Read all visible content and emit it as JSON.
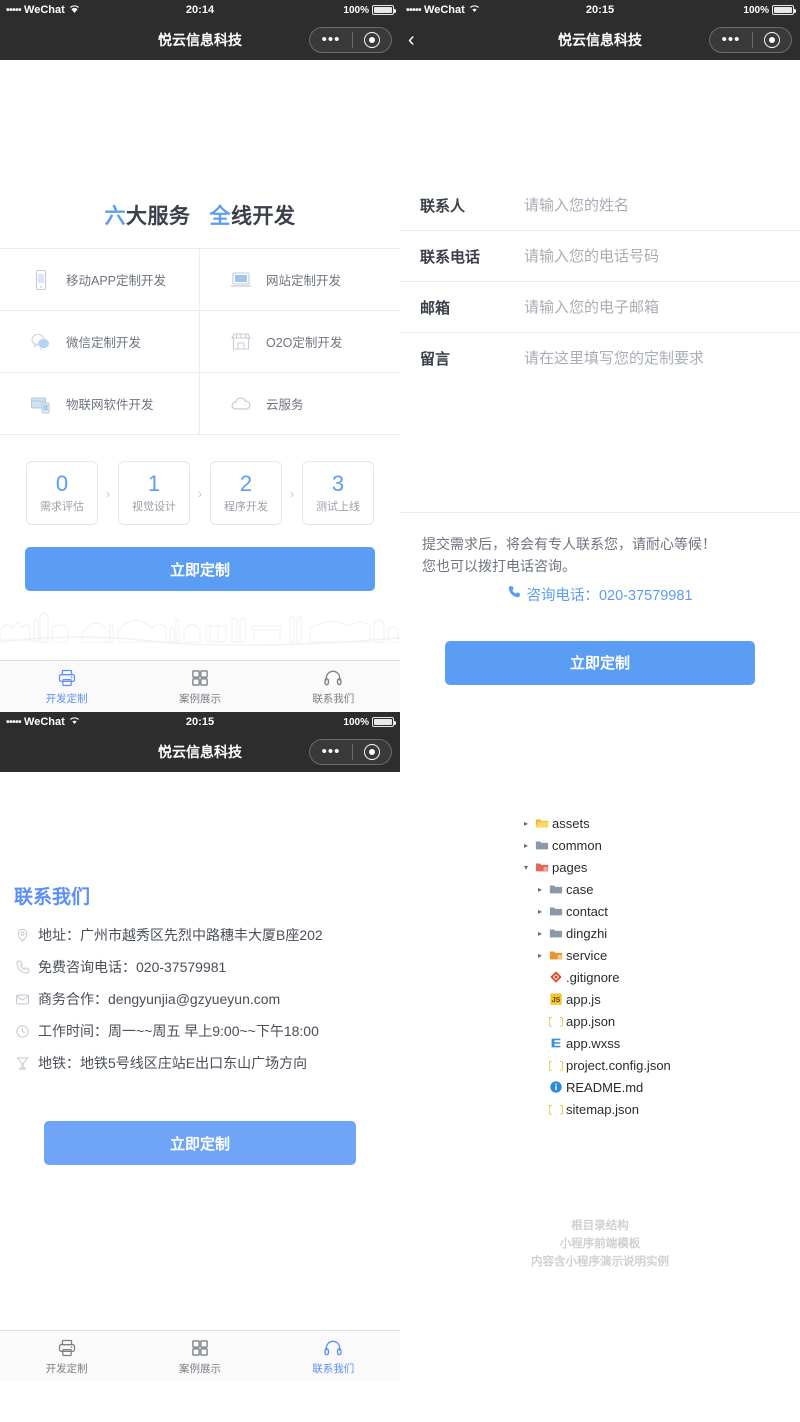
{
  "panel1": {
    "status": {
      "dots": "•••••",
      "carrier": "WeChat",
      "wifi": "wifi-icon",
      "time": "20:14",
      "battery_pct": "100%"
    },
    "nav": {
      "title": "悦云信息科技",
      "has_back": false,
      "menu_icon": "more-dots-icon",
      "target_icon": "target-circle-icon"
    },
    "section_title": {
      "part1_highlight": "六",
      "part1_rest": "大服务",
      "part2_highlight": "全",
      "part2_rest": "线开发"
    },
    "services": [
      {
        "label": "移动APP定制开发",
        "icon": "mobile-phone-icon"
      },
      {
        "label": "网站定制开发",
        "icon": "laptop-icon"
      },
      {
        "label": "微信定制开发",
        "icon": "wechat-bubble-icon"
      },
      {
        "label": "O2O定制开发",
        "icon": "storefront-icon"
      },
      {
        "label": "物联网软件开发",
        "icon": "iot-devices-icon"
      },
      {
        "label": "云服务",
        "icon": "cloud-icon"
      }
    ],
    "steps": [
      {
        "num": "0",
        "label": "需求评估"
      },
      {
        "num": "1",
        "label": "视觉设计"
      },
      {
        "num": "2",
        "label": "程序开发"
      },
      {
        "num": "3",
        "label": "测试上线"
      }
    ],
    "step_arrow": "›",
    "cta_label": "立即定制",
    "tabs": [
      {
        "label": "开发定制",
        "icon": "printer-custom-icon",
        "active": true
      },
      {
        "label": "案例展示",
        "icon": "grid-squares-icon",
        "active": false
      },
      {
        "label": "联系我们",
        "icon": "headset-icon",
        "active": false
      }
    ]
  },
  "panel2": {
    "status": {
      "dots": "•••••",
      "carrier": "WeChat",
      "wifi": "wifi-icon",
      "time": "20:15",
      "battery_pct": "100%"
    },
    "nav": {
      "title": "悦云信息科技",
      "has_back": true,
      "back_icon": "chevron-left-icon",
      "menu_icon": "more-dots-icon",
      "target_icon": "target-circle-icon"
    },
    "form": [
      {
        "label": "联系人",
        "placeholder": "请输入您的姓名"
      },
      {
        "label": "联系电话",
        "placeholder": "请输入您的电话号码"
      },
      {
        "label": "邮箱",
        "placeholder": "请输入您的电子邮箱"
      },
      {
        "label": "留言",
        "placeholder": "请在这里填写您的定制要求"
      }
    ],
    "note_line1": "提交需求后，将会有专人联系您，请耐心等候！",
    "note_line2": "您也可以拨打电话咨询。",
    "phone_icon": "phone-handset-icon",
    "phone_text": "咨询电话：020-37579981",
    "cta_label": "立即定制"
  },
  "panel3": {
    "status": {
      "dots": "•••••",
      "carrier": "WeChat",
      "wifi": "wifi-icon",
      "time": "20:15",
      "battery_pct": "100%"
    },
    "nav": {
      "title": "悦云信息科技",
      "has_back": false,
      "menu_icon": "more-dots-icon",
      "target_icon": "target-circle-icon"
    },
    "title": "联系我们",
    "items": [
      {
        "icon": "location-pin-icon",
        "text": "地址：广州市越秀区先烈中路穗丰大厦B座202"
      },
      {
        "icon": "phone-handset-icon",
        "text": "免费咨询电话：020-37579981"
      },
      {
        "icon": "envelope-icon",
        "text": "商务合作：dengyunjia@gzyueyun.com"
      },
      {
        "icon": "clock-icon",
        "text": "工作时间：周一~~周五 早上9:00~~下午18:00"
      },
      {
        "icon": "subway-icon",
        "text": "地铁：地铁5号线区庄站E出口东山广场方向"
      }
    ],
    "cta_label": "立即定制",
    "tabs": [
      {
        "label": "开发定制",
        "icon": "printer-custom-icon",
        "active": false
      },
      {
        "label": "案例展示",
        "icon": "grid-squares-icon",
        "active": false
      },
      {
        "label": "联系我们",
        "icon": "headset-icon",
        "active": true
      }
    ]
  },
  "filetree": {
    "rows": [
      {
        "name": "assets",
        "type": "folder-open-yellow",
        "depth": 1,
        "arrow": "▸"
      },
      {
        "name": "common",
        "type": "folder-gray",
        "depth": 1,
        "arrow": "▸"
      },
      {
        "name": "pages",
        "type": "folder-red",
        "depth": 1,
        "arrow": "▾"
      },
      {
        "name": "case",
        "type": "folder-gray",
        "depth": 2,
        "arrow": "▸"
      },
      {
        "name": "contact",
        "type": "folder-gray",
        "depth": 2,
        "arrow": "▸"
      },
      {
        "name": "dingzhi",
        "type": "folder-gray",
        "depth": 2,
        "arrow": "▸"
      },
      {
        "name": "service",
        "type": "folder-orange",
        "depth": 2,
        "arrow": "▸"
      },
      {
        "name": ".gitignore",
        "type": "git-icon",
        "depth": 2,
        "arrow": ""
      },
      {
        "name": "app.js",
        "type": "js-icon",
        "depth": 2,
        "arrow": ""
      },
      {
        "name": "app.json",
        "type": "json-icon",
        "depth": 2,
        "arrow": ""
      },
      {
        "name": "app.wxss",
        "type": "css-icon",
        "depth": 2,
        "arrow": ""
      },
      {
        "name": "project.config.json",
        "type": "json-icon",
        "depth": 2,
        "arrow": ""
      },
      {
        "name": "README.md",
        "type": "info-icon",
        "depth": 2,
        "arrow": ""
      },
      {
        "name": "sitemap.json",
        "type": "json-icon",
        "depth": 2,
        "arrow": ""
      }
    ],
    "watermark_line1": "根目录结构",
    "watermark_line2": "小程序前端模板",
    "watermark_line3": "内容含小程序演示说明实例"
  },
  "colors": {
    "accent_blue": "#5b9cf5",
    "tab_active": "#5b8ff9",
    "navbar_dark": "#2d2d2d",
    "text_dark": "#3a3f4a",
    "text_muted": "#9aa0a8"
  }
}
